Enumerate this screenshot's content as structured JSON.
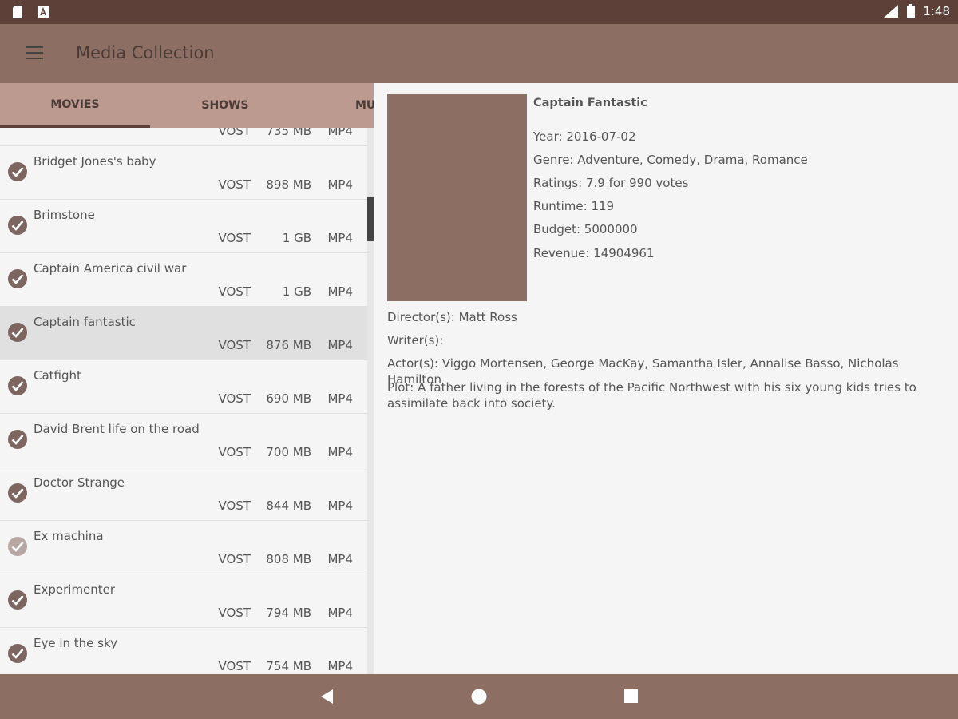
{
  "status_bar": {
    "time": "1:48",
    "left_icons": [
      "sd-card-icon",
      "notification-a-icon"
    ],
    "right_icons": [
      "signal-icon",
      "battery-icon"
    ]
  },
  "app_bar": {
    "title": "Media Collection",
    "menu_icon": "menu-icon"
  },
  "tabs": [
    {
      "label": "MOVIES",
      "active": true
    },
    {
      "label": "SHOWS",
      "active": false
    },
    {
      "label": "MU",
      "active": false
    }
  ],
  "movies": [
    {
      "title": "",
      "lang": "VOST",
      "size": "735 MB",
      "format": "MP4",
      "checked": true
    },
    {
      "title": "Bridget Jones's baby",
      "lang": "VOST",
      "size": "898 MB",
      "format": "MP4",
      "checked": true
    },
    {
      "title": "Brimstone",
      "lang": "VOST",
      "size": "1 GB",
      "format": "MP4",
      "checked": true
    },
    {
      "title": "Captain America civil war",
      "lang": "VOST",
      "size": "1 GB",
      "format": "MP4",
      "checked": true
    },
    {
      "title": "Captain fantastic",
      "lang": "VOST",
      "size": "876 MB",
      "format": "MP4",
      "checked": true,
      "selected": true
    },
    {
      "title": "Catfight",
      "lang": "VOST",
      "size": "690 MB",
      "format": "MP4",
      "checked": true
    },
    {
      "title": "David Brent life on the road",
      "lang": "VOST",
      "size": "700 MB",
      "format": "MP4",
      "checked": true
    },
    {
      "title": "Doctor Strange",
      "lang": "VOST",
      "size": "844 MB",
      "format": "MP4",
      "checked": true
    },
    {
      "title": "Ex machina",
      "lang": "VOST",
      "size": "808 MB",
      "format": "MP4",
      "checked": true,
      "dim": true
    },
    {
      "title": "Experimenter",
      "lang": "VOST",
      "size": "794 MB",
      "format": "MP4",
      "checked": true
    },
    {
      "title": "Eye in the sky",
      "lang": "VOST",
      "size": "754 MB",
      "format": "MP4",
      "checked": true
    }
  ],
  "detail": {
    "title": "Captain Fantastic",
    "year": "Year: 2016-07-02",
    "genre": "Genre: Adventure, Comedy, Drama, Romance",
    "ratings": "Ratings: 7.9 for 990 votes",
    "runtime": "Runtime: 119",
    "budget": "Budget: 5000000",
    "revenue": "Revenue: 14904961",
    "directors": "Director(s): Matt Ross",
    "writers": "Writer(s):",
    "actors": "Actor(s): Viggo Mortensen, George MacKay, Samantha Isler, Annalise Basso, Nicholas Hamilton",
    "plot": "Plot: A father living in the forests of the Pacific Northwest with his six young kids tries to assimilate back into society."
  },
  "colors": {
    "status_bar": "#5d4037",
    "app_bar": "#8d6e63",
    "tab_bar": "#bc9a90",
    "check": "#7d6560"
  },
  "nav_bar": {
    "icons": [
      "back-icon",
      "home-icon",
      "recents-icon"
    ]
  }
}
